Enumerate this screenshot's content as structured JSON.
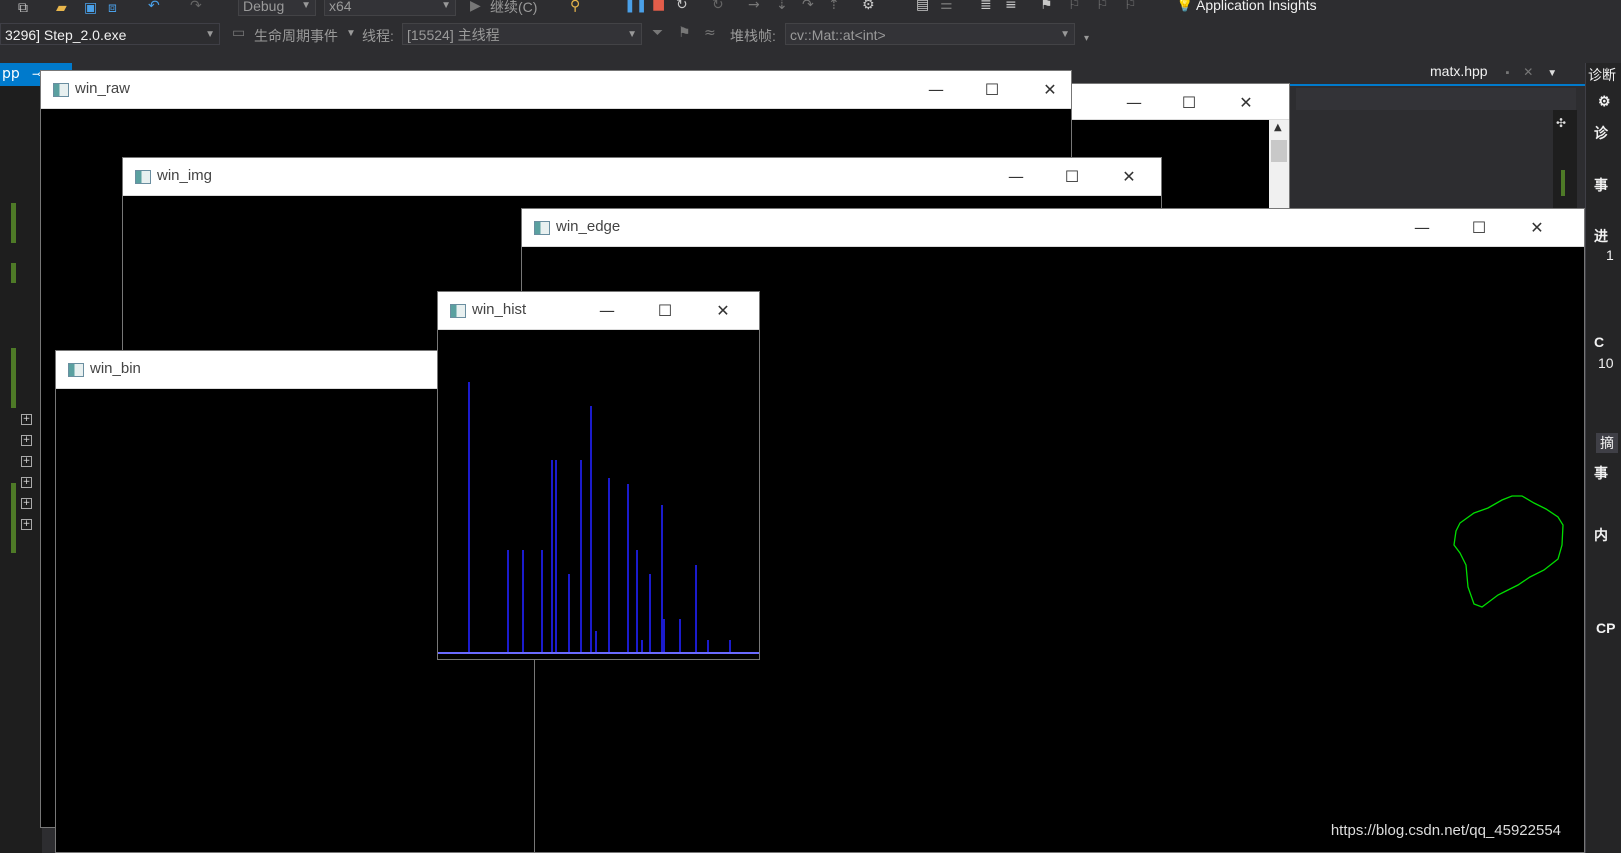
{
  "toolbar": {
    "config_label": "Debug",
    "platform_label": "x64",
    "continue_label": "继续(C)",
    "insights_label": "Application Insights",
    "process_label": "3296] Step_2.0.exe",
    "lifecycle_label": "生命周期事件",
    "thread_caption": "线程:",
    "thread_value": "[15524] 主线程",
    "stackframe_caption": "堆栈帧:",
    "stackframe_value": "cv::Mat::at<int>"
  },
  "tabs": {
    "left_tab": "pp",
    "right_tab": "matx.hpp"
  },
  "right_panel": {
    "diag_label": "诊断",
    "items": [
      "诊",
      "事",
      "进",
      "1",
      "C",
      "10",
      "摘",
      "事",
      "内",
      "CP"
    ]
  },
  "windows": {
    "win_raw": "win_raw",
    "win_img": "win_img",
    "win_edge": "win_edge",
    "win_hist": "win_hist",
    "win_bin": "win_bin"
  },
  "hist_data": {
    "bars": [
      0.9,
      0.34,
      0.34,
      0.34,
      0.64,
      0.64,
      0.26,
      0.64,
      0.82,
      0.07,
      0.58,
      0.56,
      0.34,
      0.04,
      0.26,
      0.49,
      0.11,
      0.11,
      0.29,
      0.04,
      0.04
    ],
    "color": "#2222ff",
    "baseline_color": "#6a6aff"
  },
  "edge_color": "#00dd00",
  "watermark": "https://blog.csdn.net/qq_45922554"
}
